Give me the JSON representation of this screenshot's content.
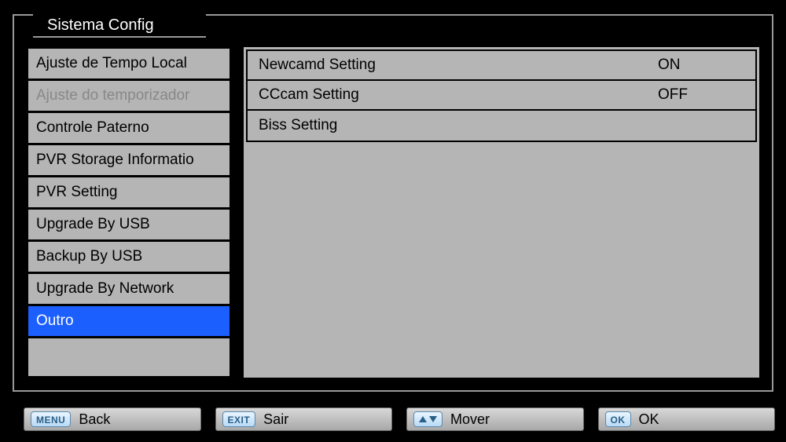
{
  "title": "Sistema Config",
  "sidebar": {
    "items": [
      {
        "label": "Ajuste de Tempo Local",
        "state": "normal"
      },
      {
        "label": "Ajuste do temporizador",
        "state": "disabled"
      },
      {
        "label": "Controle Paterno",
        "state": "normal"
      },
      {
        "label": "PVR Storage Informatio",
        "state": "normal"
      },
      {
        "label": "PVR Setting",
        "state": "normal"
      },
      {
        "label": "Upgrade By USB",
        "state": "normal"
      },
      {
        "label": "Backup By USB",
        "state": "normal"
      },
      {
        "label": "Upgrade By Network",
        "state": "normal"
      },
      {
        "label": "Outro",
        "state": "selected"
      }
    ]
  },
  "settings": {
    "rows": [
      {
        "label": "Newcamd Setting",
        "value": "ON"
      },
      {
        "label": "CCcam Setting",
        "value": "OFF"
      },
      {
        "label": "Biss Setting",
        "value": ""
      }
    ]
  },
  "footer": {
    "back": {
      "key": "MENU",
      "label": "Back"
    },
    "exit": {
      "key": "EXIT",
      "label": "Sair"
    },
    "move": {
      "label": "Mover"
    },
    "ok": {
      "key": "OK",
      "label": "OK"
    }
  }
}
